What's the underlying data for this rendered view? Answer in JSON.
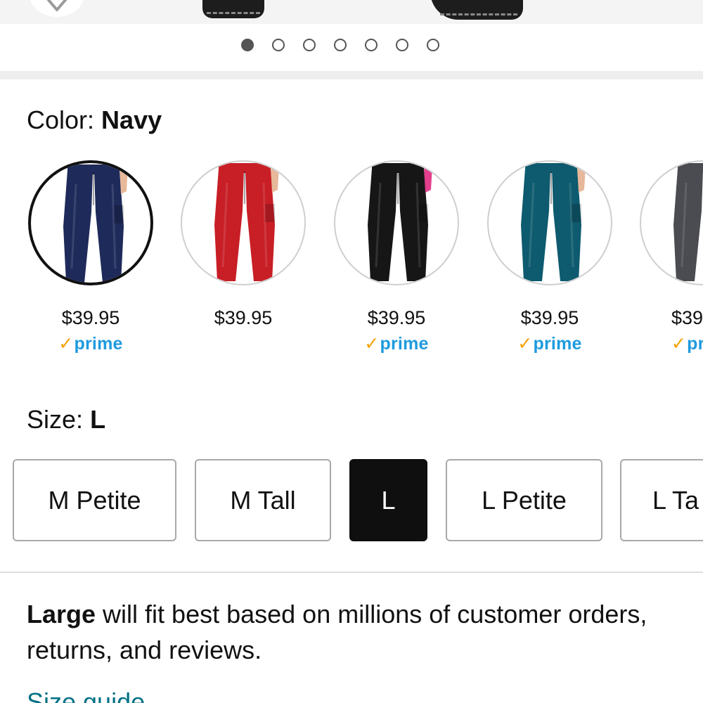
{
  "carousel": {
    "dots_total": 7,
    "active_index": 0
  },
  "color": {
    "label": "Color:",
    "selected": "Navy",
    "options": [
      {
        "name": "Navy",
        "hex": "#1e2a5a",
        "price": "$39.95",
        "prime": true,
        "selected": true
      },
      {
        "name": "Red",
        "hex": "#c81e26",
        "price": "$39.95",
        "prime": false,
        "selected": false
      },
      {
        "name": "Black",
        "hex": "#161616",
        "price": "$39.95",
        "prime": true,
        "selected": false
      },
      {
        "name": "Teal",
        "hex": "#0e5a6e",
        "price": "$39.95",
        "prime": true,
        "selected": false
      },
      {
        "name": "Gray",
        "hex": "#4a4c52",
        "price": "$39",
        "prime": true,
        "selected": false
      }
    ],
    "prime_text": "prime",
    "prime_text_partial": "pr"
  },
  "size": {
    "label": "Size:",
    "selected": "L",
    "options": [
      "M Petite",
      "M Tall",
      "L",
      "L Petite",
      "L Ta"
    ]
  },
  "fit_note": {
    "bold": "Large",
    "text": " will fit best based on millions of customer orders, returns, and reviews."
  },
  "size_guide": "Size guide",
  "colors": {
    "prime_blue": "#1f9bde",
    "prime_check": "#f4a100",
    "link": "#007185",
    "selected_size_bg": "#0f0f0f"
  },
  "icons": {
    "wishlist": "heart-icon",
    "prime_check": "checkmark-icon"
  }
}
